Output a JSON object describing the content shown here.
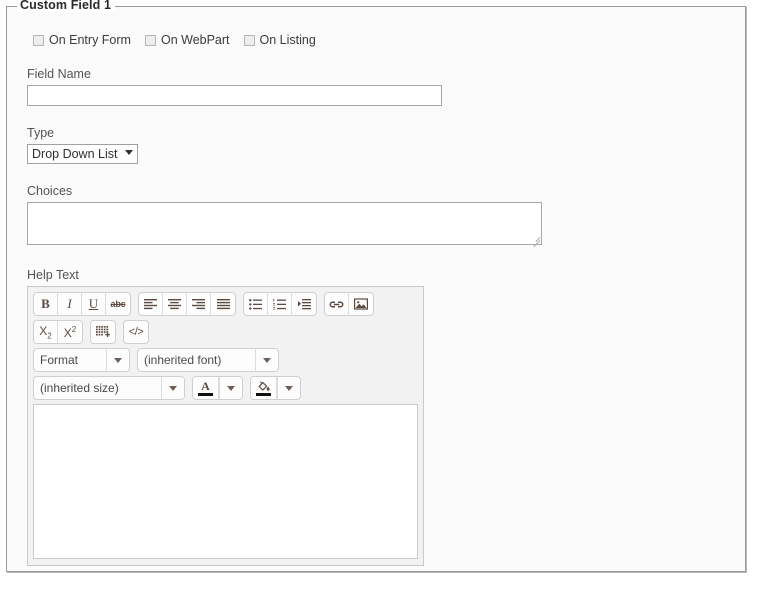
{
  "fieldset": {
    "legend": "Custom Field 1"
  },
  "visibility": {
    "checkboxes": [
      {
        "label": "On Entry Form",
        "checked": false
      },
      {
        "label": "On WebPart",
        "checked": false
      },
      {
        "label": "On Listing",
        "checked": false
      }
    ]
  },
  "field_name": {
    "label": "Field Name",
    "value": "",
    "placeholder": ""
  },
  "type": {
    "label": "Type",
    "selected": "Drop Down List"
  },
  "choices": {
    "label": "Choices",
    "value": "",
    "placeholder": ""
  },
  "help_text": {
    "label": "Help Text",
    "value": "",
    "editor": {
      "toolbar": {
        "row1": [
          {
            "group": [
              {
                "name": "bold-button",
                "glyph": "B"
              },
              {
                "name": "italic-button",
                "glyph": "I"
              },
              {
                "name": "underline-button",
                "glyph": "U"
              },
              {
                "name": "strikethrough-button",
                "glyph": "abc"
              }
            ]
          },
          {
            "group": [
              {
                "name": "align-left-button",
                "glyph": "align-left-icon"
              },
              {
                "name": "align-center-button",
                "glyph": "align-center-icon"
              },
              {
                "name": "align-right-button",
                "glyph": "align-right-icon"
              },
              {
                "name": "align-justify-button",
                "glyph": "align-justify-icon"
              }
            ]
          },
          {
            "group": [
              {
                "name": "bullet-list-button",
                "glyph": "bullet-list-icon"
              },
              {
                "name": "numbered-list-button",
                "glyph": "numbered-list-icon"
              },
              {
                "name": "indent-button",
                "glyph": "indent-icon"
              }
            ]
          },
          {
            "group": [
              {
                "name": "insert-link-button",
                "glyph": "link-icon"
              },
              {
                "name": "insert-image-button",
                "glyph": "image-icon"
              }
            ]
          }
        ],
        "row2": [
          {
            "group": [
              {
                "name": "subscript-button",
                "glyph": "X2sub"
              },
              {
                "name": "superscript-button",
                "glyph": "X2sup"
              }
            ]
          },
          {
            "group": [
              {
                "name": "insert-table-button",
                "glyph": "table-icon"
              }
            ]
          },
          {
            "group": [
              {
                "name": "source-code-button",
                "glyph": "</>"
              }
            ]
          }
        ]
      },
      "format_select": "Format",
      "font_select": "(inherited font)",
      "size_select": "(inherited size)",
      "font_color": {
        "name": "font-color-button",
        "glyph": "A",
        "swatch": "#111111"
      },
      "background_color": {
        "name": "background-color-button",
        "glyph": "paint-bucket-icon",
        "swatch": "#111111"
      }
    }
  },
  "colors": {
    "fieldset_border": "#9a9a9a",
    "panel_background": "#fbfbfb",
    "toolbar_background": "#f2f2f2",
    "icon_color": "#5b4a42",
    "label_color": "#545454"
  }
}
